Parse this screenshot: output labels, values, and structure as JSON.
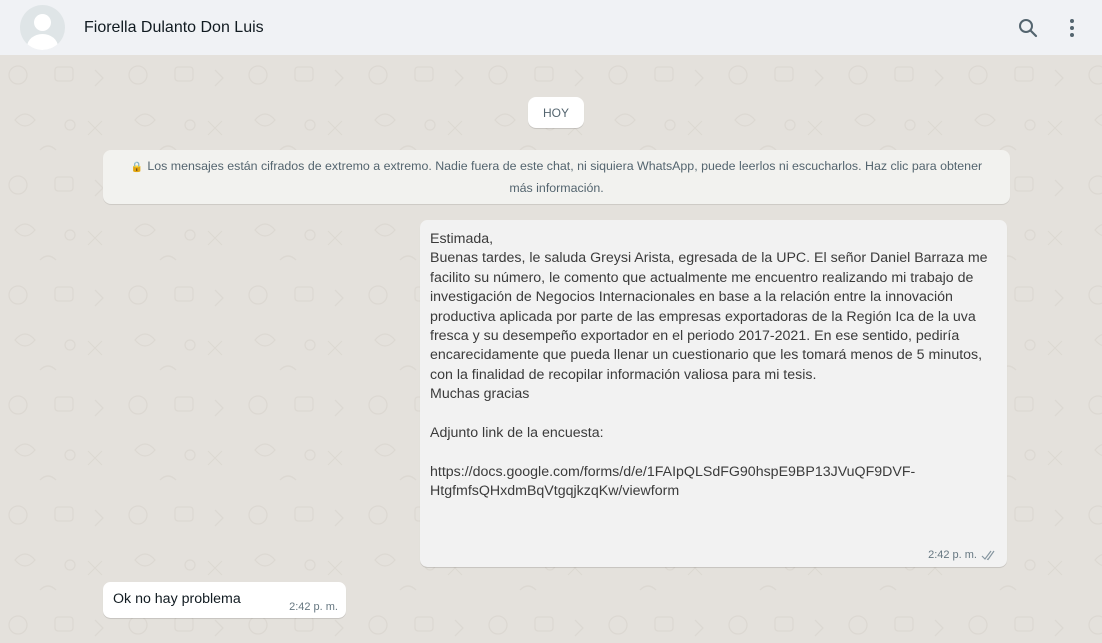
{
  "header": {
    "contact_name": "Fiorella Dulanto Don Luis",
    "icons": [
      "default-avatar-icon",
      "search-icon",
      "menu-kebab-icon"
    ]
  },
  "chat": {
    "date_label": "HOY",
    "encryption_notice": "Los mensajes están cifrados de extremo a extremo. Nadie fuera de este chat, ni siquiera WhatsApp, puede leerlos ni escucharlos. Haz clic para obtener más información.",
    "messages": [
      {
        "direction": "outgoing",
        "text": "Estimada,\nBuenas tardes, le saluda Greysi Arista, egresada de la UPC. El señor Daniel Barraza me facilito su número, le comento que actualmente me encuentro realizando mi trabajo de investigación de Negocios Internacionales en base a la relación entre la innovación productiva aplicada por parte de las empresas exportadoras de la Región Ica de la uva fresca y su desempeño exportador en el periodo 2017-2021. En ese sentido, pediría encarecidamente que pueda llenar un cuestionario que les tomará menos de 5 minutos, con la finalidad de recopilar información valiosa para mi tesis.\nMuchas gracias\n\nAdjunto link de la encuesta:\n\nhttps://docs.google.com/forms/d/e/1FAIpQLSdFG90hspE9BP13JVuQF9DVF-HtgfmfsQHxdmBqVtgqjkzqKw/viewform",
        "time": "2:42 p. m.",
        "status_icon": "double-check-icon"
      },
      {
        "direction": "incoming",
        "text": "Ok no hay problema",
        "time": "2:42 p. m."
      }
    ]
  },
  "colors": {
    "header_bg": "#f0f2f5",
    "chat_bg": "#e4e1dc",
    "outgoing_bubble": "#f2f2f2",
    "incoming_bubble": "#ffffff",
    "meta_text": "#667781"
  }
}
